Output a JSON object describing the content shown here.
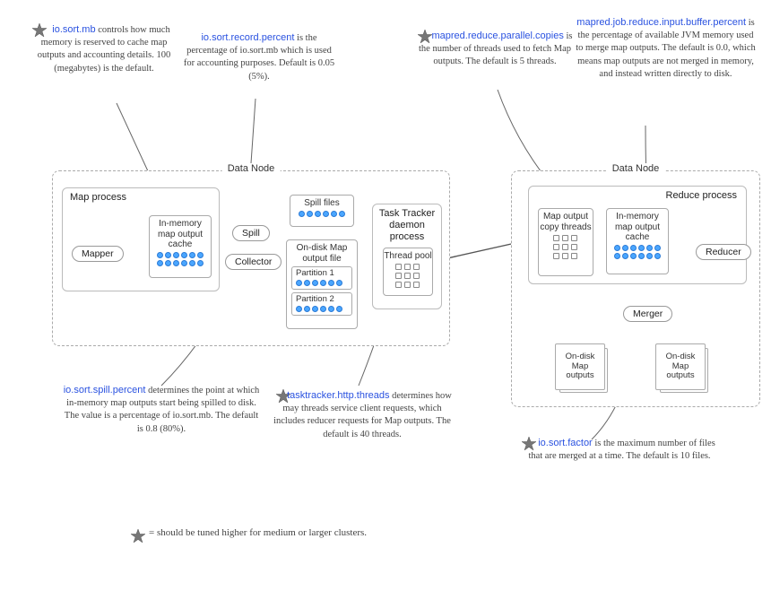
{
  "nodes": {
    "left_label": "Data Node",
    "right_label": "Data Node"
  },
  "procs": {
    "map": "Map process",
    "tasktracker": "Task Tracker daemon process",
    "tasktracker_pool": "Thread pool",
    "reduce": "Reduce process"
  },
  "boxes": {
    "mapper": "Mapper",
    "cache_left": "In-memory map output cache",
    "spill": "Spill",
    "collector": "Collector",
    "spill_files": "Spill files",
    "ondisk_file": "On-disk Map output file",
    "partition1": "Partition 1",
    "partition2": "Partition 2",
    "copy_threads": "Map output copy threads",
    "cache_right": "In-memory map output cache",
    "merger": "Merger",
    "reducer": "Reducer",
    "ondisk_out_l": "On-disk Map outputs",
    "ondisk_out_r": "On-disk Map outputs"
  },
  "ann": {
    "io_sort_mb": {
      "key": "io.sort.mb",
      "text": " controls how much memory is reserved to cache map outputs and accounting details. 100 (megabytes) is the default."
    },
    "io_sort_record_percent": {
      "key": "io.sort.record.percent",
      "text": " is the percentage of io.sort.mb which is used for accounting purposes. Default is 0.05 (5%)."
    },
    "parallel_copies": {
      "key": "mapred.reduce.parallel.copies",
      "text": " is the number of threads used to fetch Map outputs. The default is 5 threads."
    },
    "reduce_input_buffer": {
      "key": "mapred.job.reduce.input.buffer.percent",
      "text": " is the percentage of available JVM memory used to merge map outputs. The default is 0.0, which means map outputs are not merged in memory, and instead written directly to disk."
    },
    "spill_percent": {
      "key": "io.sort.spill.percent",
      "text": " determines the point at which in-memory map outputs start being spilled to disk. The value is a percentage of io.sort.mb. The default is 0.8 (80%)."
    },
    "http_threads": {
      "key": "tasktracker.http.threads",
      "text": " determines how may threads service client requests, which includes reducer requests for Map outputs. The default is 40 threads."
    },
    "io_sort_factor": {
      "key": "io.sort.factor",
      "text": " is the maximum number of files that are merged at a time. The default is 10 files."
    }
  },
  "legend": "= should be tuned higher for medium or larger clusters."
}
